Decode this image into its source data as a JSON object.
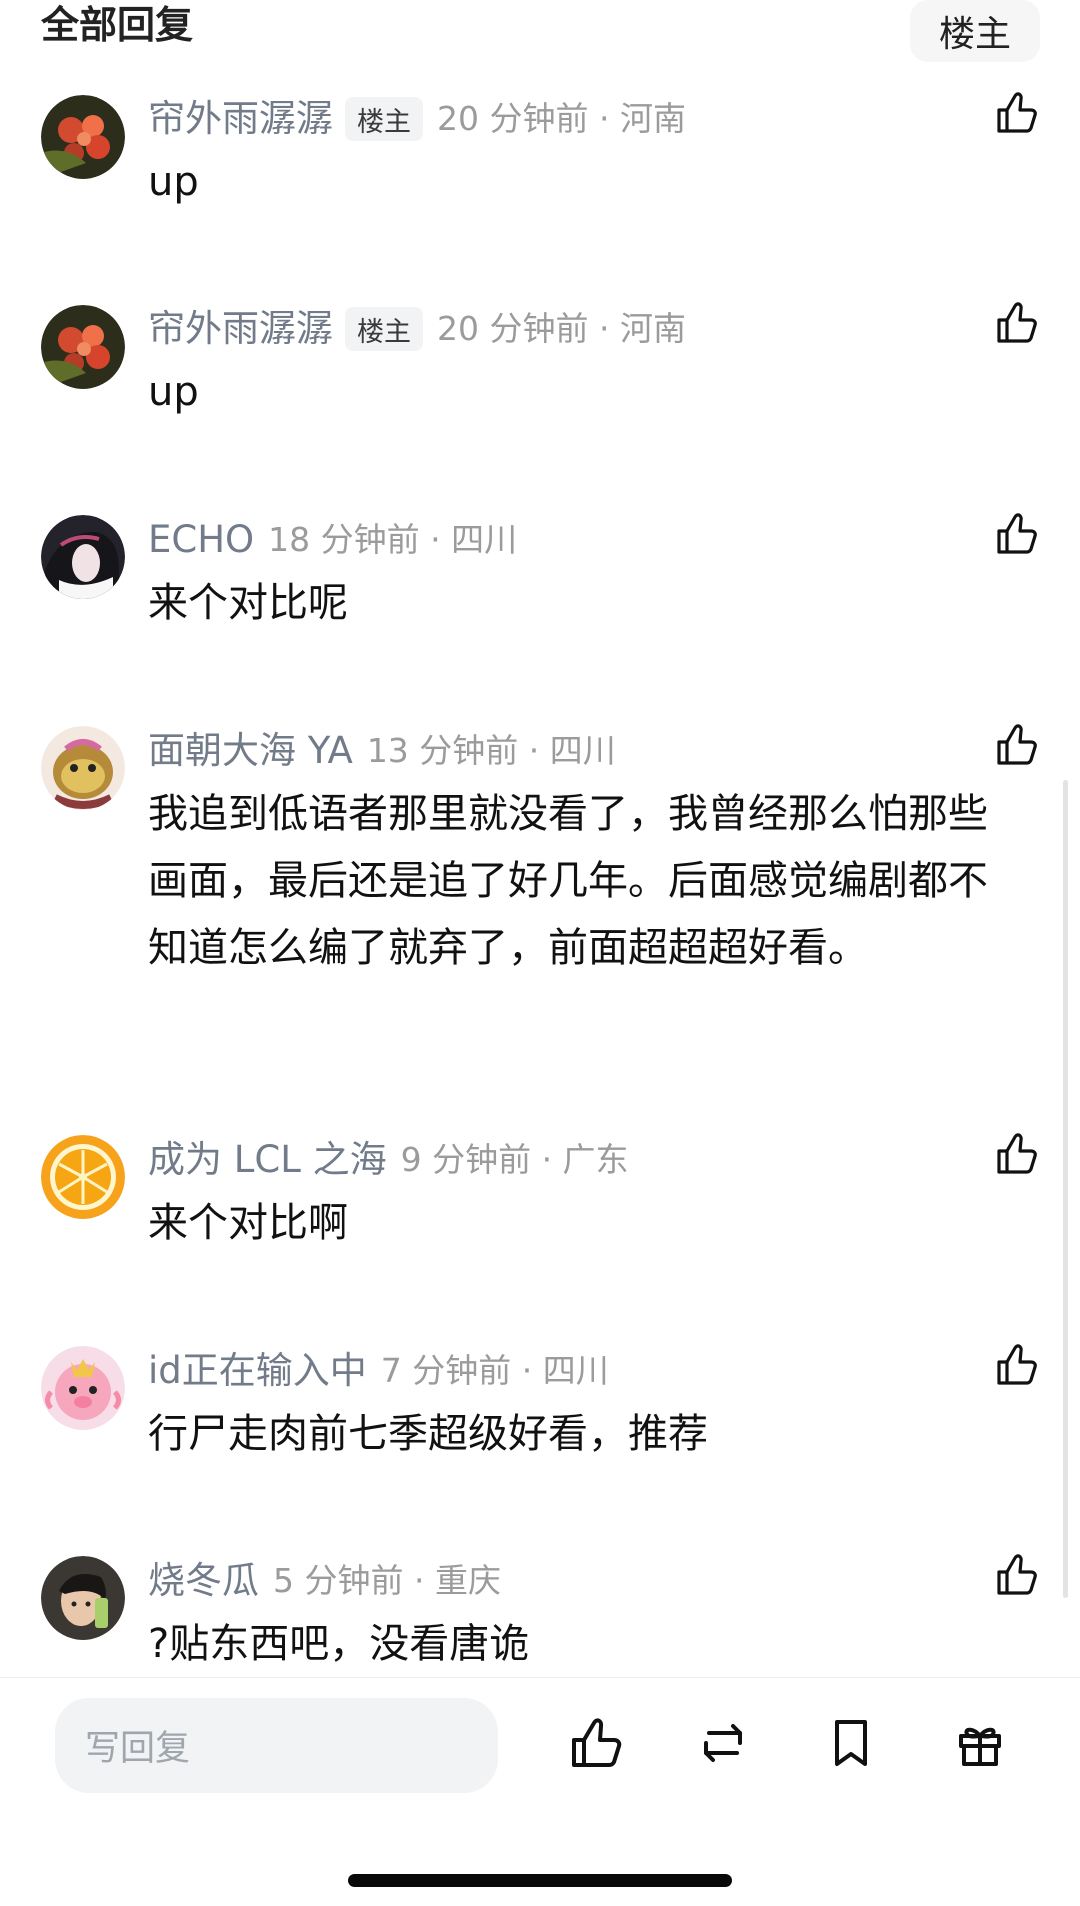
{
  "header": {
    "title": "全部回复",
    "filter_label": "楼主"
  },
  "comments": [
    {
      "username": "帘外雨潺潺",
      "badge": "楼主",
      "meta": "20 分钟前 · 河南",
      "text": "up"
    },
    {
      "username": "帘外雨潺潺",
      "badge": "楼主",
      "meta": "20 分钟前 · 河南",
      "text": "up"
    },
    {
      "username": "ECHO",
      "meta": "18 分钟前 · 四川",
      "text": "来个对比呢"
    },
    {
      "username": "面朝大海 YA",
      "meta": "13 分钟前 · 四川",
      "text": "我追到低语者那里就没看了，我曾经那么怕那些画面，最后还是追了好几年。后面感觉编剧都不知道怎么编了就弃了，前面超超超好看。"
    },
    {
      "username": "成为 LCL 之海",
      "meta": "9 分钟前 · 广东",
      "text": "来个对比啊"
    },
    {
      "username": "id正在输入中",
      "meta": "7 分钟前 · 四川",
      "text": "行尸走肉前七季超级好看，推荐"
    },
    {
      "username": "烧冬瓜",
      "meta": "5 分钟前 · 重庆",
      "text": "?贴东西吧，没看唐诡"
    }
  ],
  "bottom_bar": {
    "reply_placeholder": "写回复",
    "actions": [
      "thumb-up-icon",
      "repost-icon",
      "bookmark-icon",
      "gift-icon"
    ]
  }
}
